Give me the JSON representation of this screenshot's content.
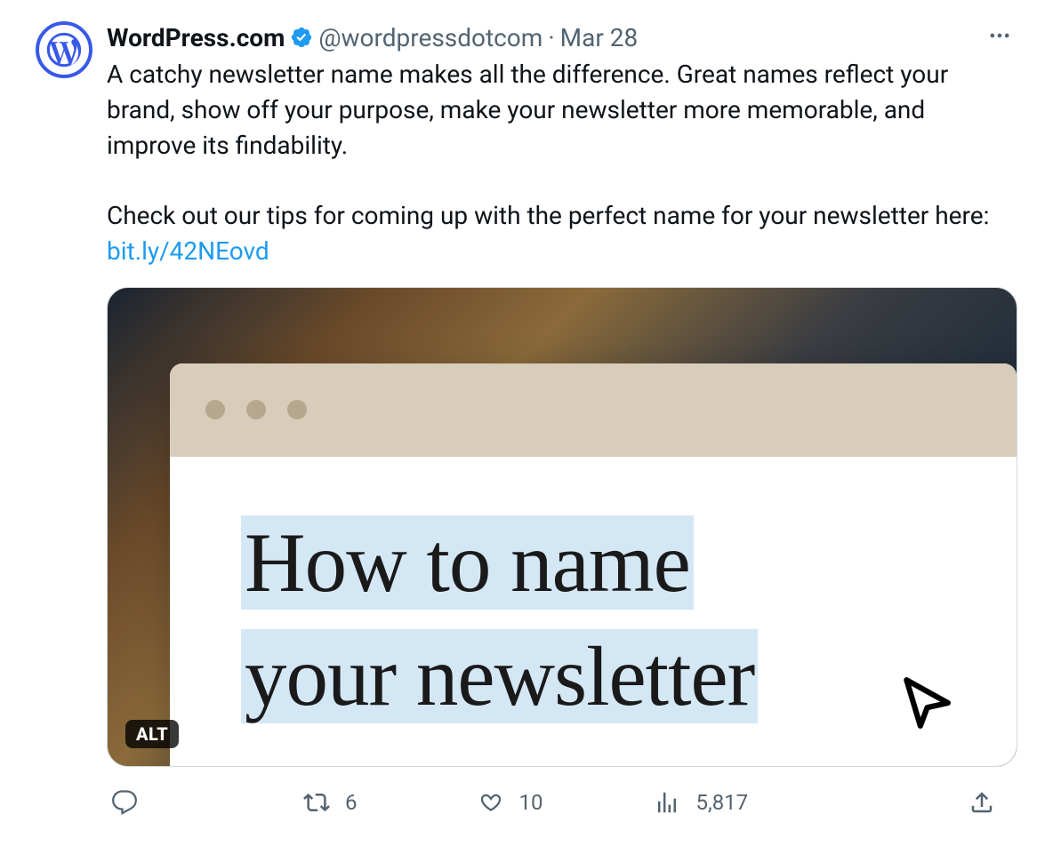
{
  "tweet": {
    "display_name": "WordPress.com",
    "handle": "@wordpressdotcom",
    "separator": "·",
    "date": "Mar 28",
    "body_text_1": "A catchy newsletter name makes all the difference. Great names reflect your brand, show off your purpose, make your newsletter more memorable, and improve its findability.",
    "body_text_2": "Check out our tips for coming up with the perfect name for your newsletter here: ",
    "link_text": "bit.ly/42NEovd",
    "media": {
      "alt_badge": "ALT",
      "headline_line_1": "How to name",
      "headline_line_2": "your newsletter"
    },
    "actions": {
      "reply_count": "",
      "retweet_count": "6",
      "like_count": "10",
      "views_count": "5,817"
    }
  }
}
